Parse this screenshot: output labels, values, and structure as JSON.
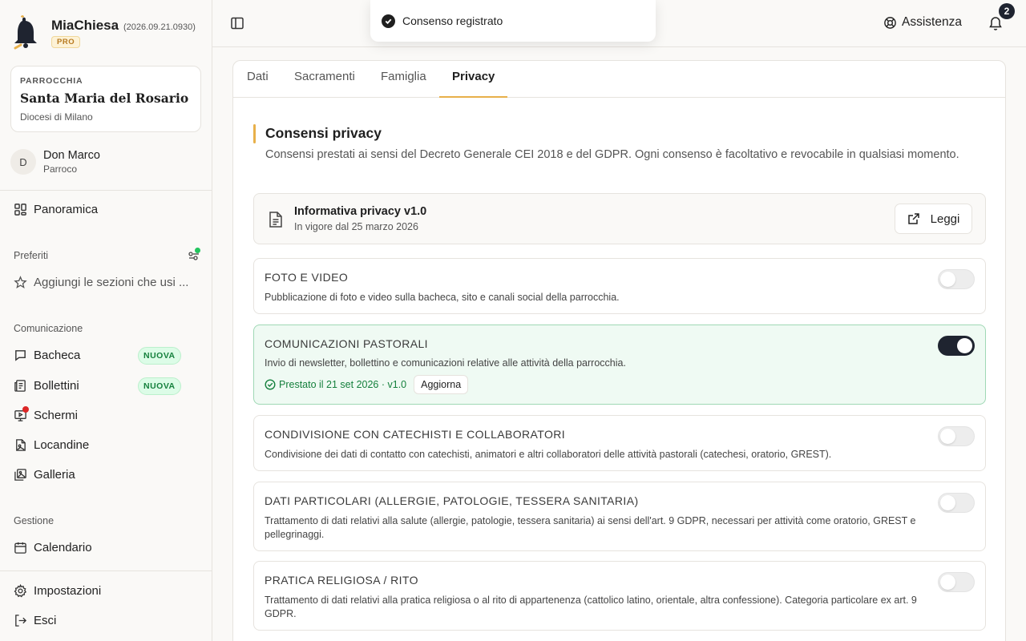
{
  "app": {
    "name": "MiaChiesa",
    "version": "(2026.09.21.0930)",
    "plan_badge": "PRO"
  },
  "parish": {
    "label": "PARROCCHIA",
    "name": "Santa Maria del Rosario",
    "diocese": "Diocesi di Milano"
  },
  "user": {
    "initial": "D",
    "name": "Don Marco",
    "role": "Parroco"
  },
  "sidebar": {
    "overview": "Panoramica",
    "favorites_label": "Preferiti",
    "favorites_add": "Aggiungi le sezioni che usi ...",
    "communication_label": "Comunicazione",
    "communication_items": [
      {
        "label": "Bacheca",
        "badge": "NUOVA"
      },
      {
        "label": "Bollettini",
        "badge": "NUOVA"
      },
      {
        "label": "Schermi"
      },
      {
        "label": "Locandine"
      },
      {
        "label": "Galleria"
      }
    ],
    "management_label": "Gestione",
    "calendar": "Calendario",
    "settings": "Impostazioni",
    "logout": "Esci"
  },
  "header": {
    "help": "Assistenza",
    "notifications_count": "2"
  },
  "toast": {
    "message": "Consenso registrato"
  },
  "tabs": [
    "Dati",
    "Sacramenti",
    "Famiglia",
    "Privacy"
  ],
  "active_tab": "Privacy",
  "privacy": {
    "title": "Consensi privacy",
    "description": "Consensi prestati ai sensi del Decreto Generale CEI 2018 e del GDPR. Ogni consenso è facoltativo e revocabile in qualsiasi momento.",
    "policy": {
      "title": "Informativa privacy v1.0",
      "subtitle": "In vigore dal 25 marzo 2026",
      "read_button": "Leggi"
    },
    "consents": [
      {
        "title": "FOTO E VIDEO",
        "description": "Pubblicazione di foto e video sulla bacheca, sito e canali social della parrocchia.",
        "enabled": false
      },
      {
        "title": "COMUNICAZIONI PASTORALI",
        "description": "Invio di newsletter, bollettino e comunicazioni relative alle attività della parrocchia.",
        "enabled": true,
        "given_text": "Prestato il 21 set 2026 · v1.0",
        "update_button": "Aggiorna"
      },
      {
        "title": "CONDIVISIONE CON CATECHISTI E COLLABORATORI",
        "description": "Condivisione dei dati di contatto con catechisti, animatori e altri collaboratori delle attività pastorali (catechesi, oratorio, GREST).",
        "enabled": false
      },
      {
        "title": "DATI PARTICOLARI (ALLERGIE, PATOLOGIE, TESSERA SANITARIA)",
        "description": "Trattamento di dati relativi alla salute (allergie, patologie, tessera sanitaria) ai sensi dell'art. 9 GDPR, necessari per attività come oratorio, GREST e pellegrinaggi.",
        "enabled": false
      },
      {
        "title": "PRATICA RELIGIOSA / RITO",
        "description": "Trattamento di dati relativi alla pratica religiosa o al rito di appartenenza (cattolico latino, orientale, altra confessione). Categoria particolare ex art. 9 GDPR.",
        "enabled": false
      }
    ]
  },
  "colors": {
    "accent": "#e8b04a",
    "success": "#15803d",
    "toggle_on": "#1f2430",
    "notification_dot": "#dc2626",
    "online_dot": "#22c55e"
  }
}
